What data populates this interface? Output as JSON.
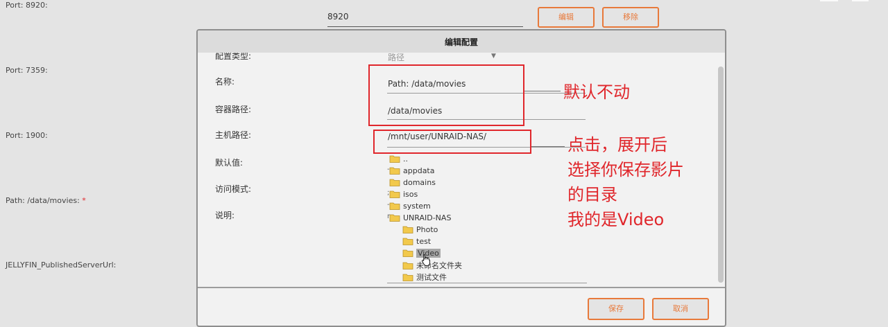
{
  "background": {
    "labels": [
      {
        "text": "Port: 8920:"
      },
      {
        "text": "Port: 7359:"
      },
      {
        "text": "Port: 1900:"
      },
      {
        "text": "Path: /data/movies: "
      },
      {
        "text": "JELLYFIN_PublishedServerUrl:"
      }
    ],
    "required_mark": "*",
    "port_value": "8920",
    "edit_label": "编辑",
    "remove_label": "移除"
  },
  "dialog": {
    "title": "编辑配置",
    "fields": {
      "config_type_label": "配置类型:",
      "config_type_value": "路径",
      "name_label": "名称:",
      "name_value": "Path: /data/movies",
      "container_path_label": "容器路径:",
      "container_path_value": "/data/movies",
      "host_path_label": "主机路径:",
      "host_path_value": "/mnt/user/UNRAID-NAS/",
      "default_label": "默认值:",
      "access_mode_label": "访问模式:",
      "description_label": "说明:"
    },
    "tree": [
      {
        "label": ".."
      },
      {
        "label": "appdata"
      },
      {
        "label": "domains"
      },
      {
        "label": "isos"
      },
      {
        "label": "system"
      },
      {
        "label": "UNRAID-NAS"
      },
      {
        "label": "Photo"
      },
      {
        "label": "test"
      },
      {
        "label": "Video"
      },
      {
        "label": "未命名文件夹"
      },
      {
        "label": "测试文件"
      }
    ],
    "save_label": "保存",
    "cancel_label": "取消"
  },
  "annotations": {
    "note1": "默认不动",
    "note2_lines": [
      "点击，展开后",
      "选择你保存影片",
      "的目录",
      "我的是Video"
    ]
  },
  "colors": {
    "accent": "#e8793a",
    "annotation": "#e0262b",
    "folder": "#f2c94c"
  }
}
